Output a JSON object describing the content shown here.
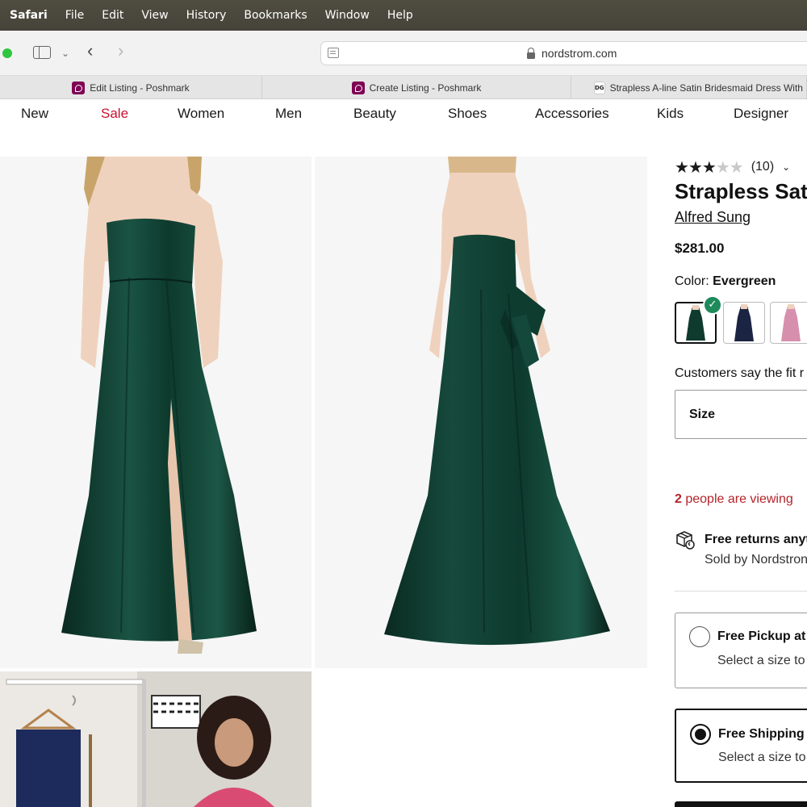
{
  "menubar": {
    "app": "Safari",
    "items": [
      "File",
      "Edit",
      "View",
      "History",
      "Bookmarks",
      "Window",
      "Help"
    ]
  },
  "toolbar": {
    "url": "nordstrom.com"
  },
  "tabs": [
    {
      "label": "Edit Listing - Poshmark",
      "favicon": "poshmark-icon"
    },
    {
      "label": "Create Listing - Poshmark",
      "favicon": "poshmark-icon"
    },
    {
      "label": "Strapless A-line Satin Bridesmaid Dress With Pockets",
      "favicon": "dg-icon",
      "favicon_text": "DG"
    }
  ],
  "site_nav": {
    "items": [
      "New",
      "Sale",
      "Women",
      "Men",
      "Beauty",
      "Shoes",
      "Accessories",
      "Kids",
      "Designer"
    ]
  },
  "product": {
    "rating": 3,
    "rating_max": 5,
    "review_count": "(10)",
    "title": "Strapless Satin",
    "brand": "Alfred Sung",
    "price": "$281.00",
    "color_label": "Color:",
    "color_value": "Evergreen",
    "swatches": [
      {
        "name": "Evergreen",
        "color": "#0f3b2e",
        "selected": true
      },
      {
        "name": "Navy",
        "color": "#1b2442",
        "selected": false
      },
      {
        "name": "Pink",
        "color": "#d78fae",
        "selected": false
      }
    ],
    "fit_text": "Customers say the fit r",
    "size_label": "Size",
    "viewing_count": "2",
    "viewing_text": " people are viewing",
    "returns_title": "Free returns anyti",
    "returns_sub": "Sold by Nordstron",
    "pickup": {
      "title": "Free Pickup at ",
      "sub": "Select a size to"
    },
    "shipping": {
      "title": "Free Shipping t",
      "sub": "Select a size to"
    }
  },
  "colors": {
    "dress": "#0f3b2e",
    "sale": "#c8102e",
    "viewing": "#b4232a",
    "check": "#1f8a5b"
  }
}
